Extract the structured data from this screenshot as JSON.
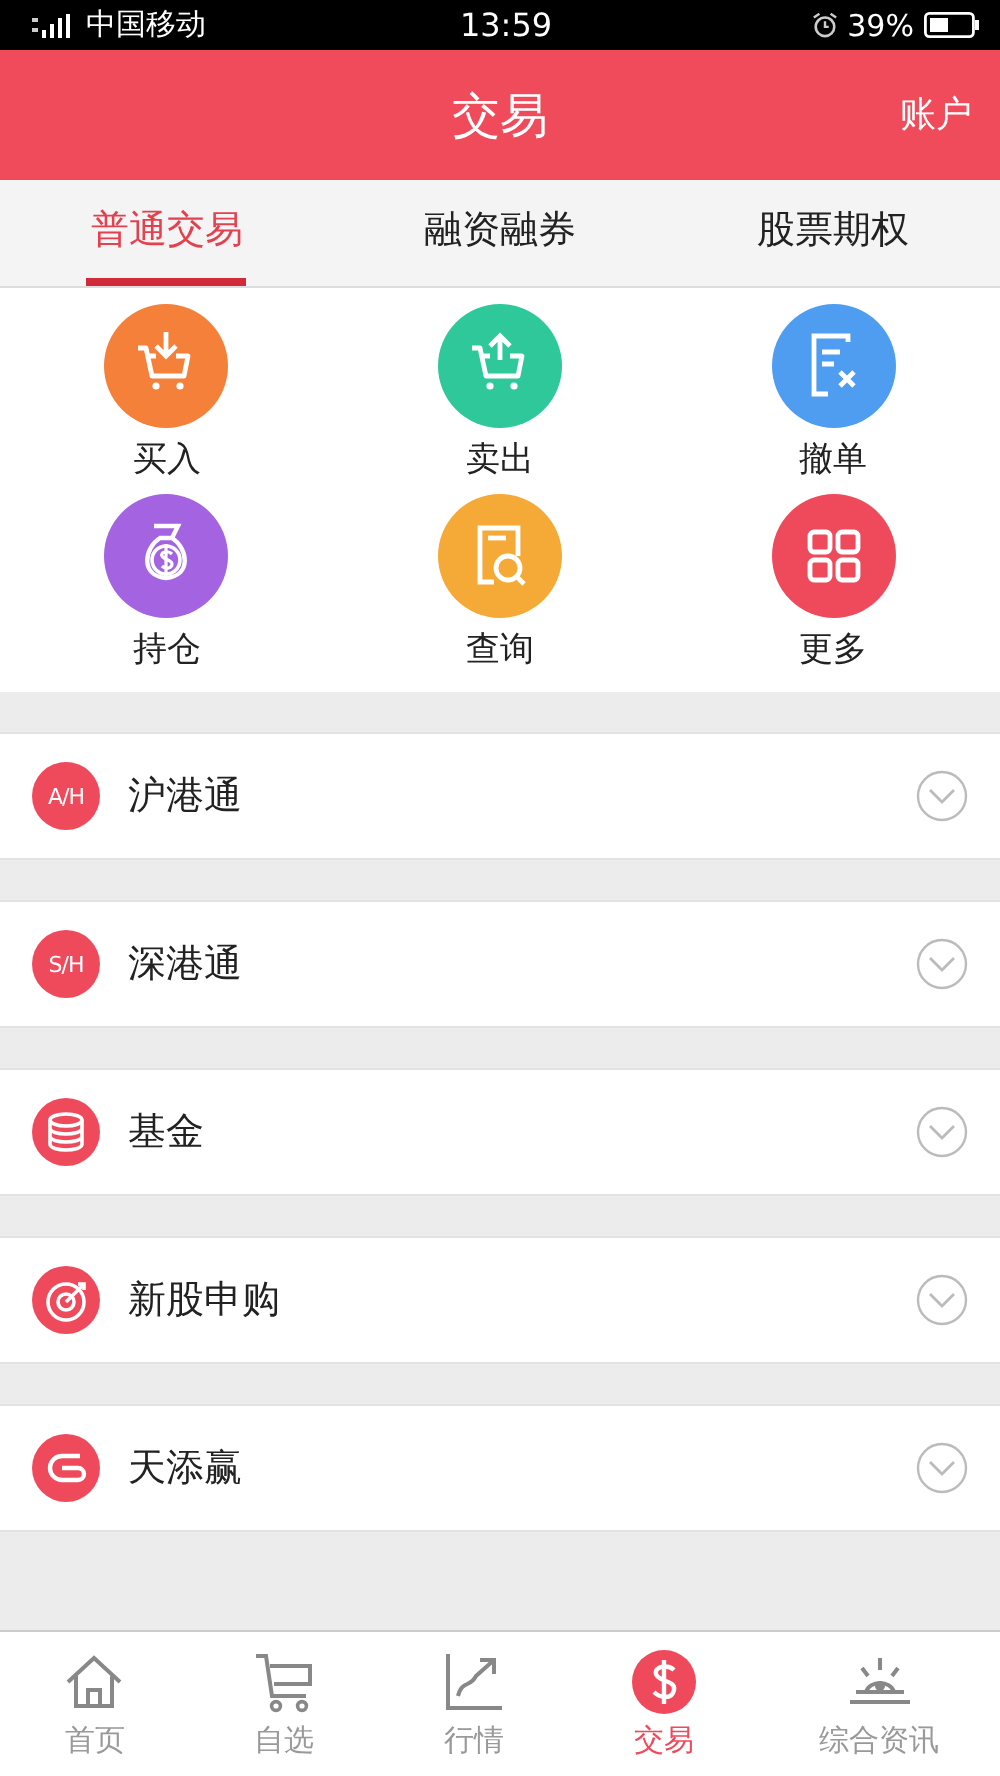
{
  "status_bar": {
    "carrier": "中国移动",
    "time": "13:59",
    "battery": "39%"
  },
  "header": {
    "title": "交易",
    "action": "账户"
  },
  "tabs": [
    {
      "label": "普通交易",
      "selected": true
    },
    {
      "label": "融资融券",
      "selected": false
    },
    {
      "label": "股票期权",
      "selected": false
    }
  ],
  "actions": [
    {
      "label": "买入"
    },
    {
      "label": "卖出"
    },
    {
      "label": "撤单"
    },
    {
      "label": "持仓"
    },
    {
      "label": "查询"
    },
    {
      "label": "更多"
    }
  ],
  "sections": [
    {
      "kind": "badge",
      "badge": "A/H",
      "label": "沪港通",
      "expanded": false
    },
    {
      "kind": "badge",
      "badge": "S/H",
      "label": "深港通",
      "expanded": false
    },
    {
      "kind": "coins",
      "label": "基金",
      "expanded": false
    },
    {
      "kind": "target",
      "label": "新股申购",
      "expanded": false
    },
    {
      "kind": "loop",
      "label": "天添赢",
      "expanded": false
    }
  ],
  "bottom_nav": [
    {
      "label": "首页",
      "selected": false
    },
    {
      "label": "自选",
      "selected": false
    },
    {
      "label": "行情",
      "selected": false
    },
    {
      "label": "交易",
      "selected": true
    },
    {
      "label": "综合资讯",
      "selected": false
    }
  ]
}
